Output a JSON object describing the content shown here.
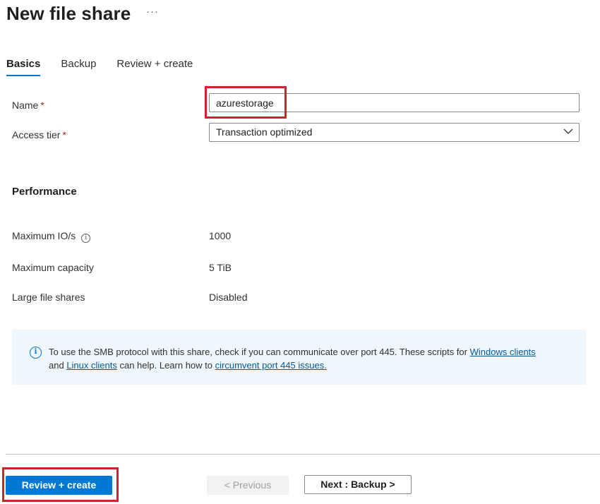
{
  "header": {
    "title": "New file share",
    "more_label": "···"
  },
  "tabs": [
    {
      "label": "Basics",
      "active": true
    },
    {
      "label": "Backup",
      "active": false
    },
    {
      "label": "Review + create",
      "active": false
    }
  ],
  "form": {
    "name_label": "Name",
    "name_value": "azurestorage",
    "access_tier_label": "Access tier",
    "access_tier_value": "Transaction optimized",
    "required_mark": "*"
  },
  "performance": {
    "heading": "Performance",
    "rows": [
      {
        "label": "Maximum IO/s",
        "value": "1000",
        "info_icon": "info-icon"
      },
      {
        "label": "Maximum capacity",
        "value": "5 TiB"
      },
      {
        "label": "Large file shares",
        "value": "Disabled"
      }
    ]
  },
  "infobar": {
    "icon": "info-icon",
    "text_part1": "To use the SMB protocol with this share, check if you can communicate over port 445. These scripts for ",
    "link_windows": "Windows clients",
    "text_part2": " and ",
    "link_linux": "Linux clients",
    "text_part3": " can help. Learn how to ",
    "link_circumvent": "circumvent port 445 issues."
  },
  "footer": {
    "review_create_label": "Review + create",
    "previous_label": "< Previous",
    "next_label": "Next : Backup >"
  },
  "colors": {
    "accent": "#0078d4",
    "highlight_box": "#d0232b",
    "info_background": "#eff6fc"
  }
}
